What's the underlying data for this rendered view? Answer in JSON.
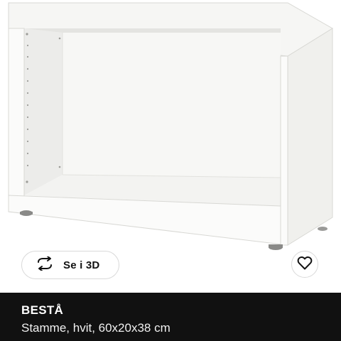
{
  "product": {
    "name": "BESTÅ",
    "description": "Stamme, hvit, 60x20x38 cm"
  },
  "actions": {
    "view_3d_label": "Se i 3D",
    "view_3d_icon": "rotate-arrows-icon",
    "favourite_icon": "heart-icon"
  },
  "colors": {
    "info_bar_background": "#111111",
    "info_bar_text": "#ffffff",
    "button_border": "#d9d9d9"
  }
}
